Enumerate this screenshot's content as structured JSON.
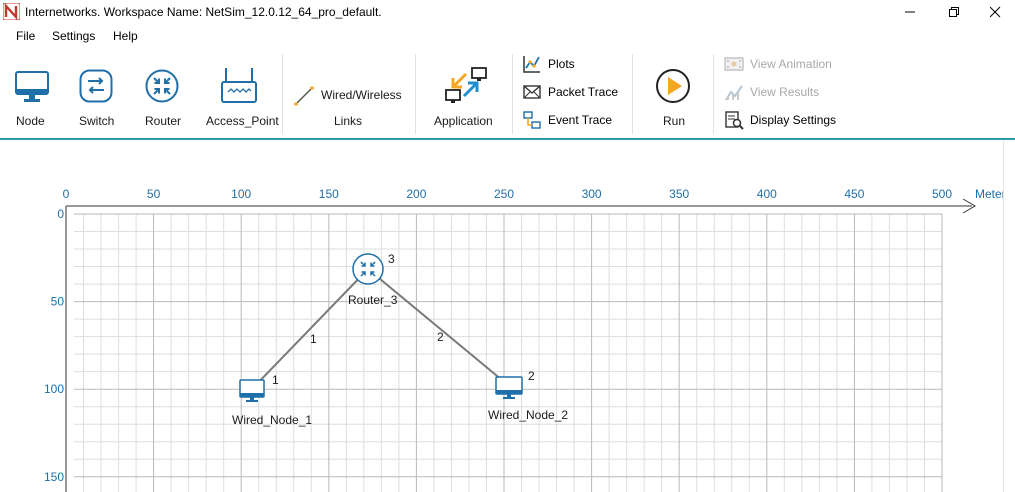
{
  "window": {
    "title": "Internetworks. Workspace Name: NetSim_12.0.12_64_pro_default.",
    "app_icon": "netsim-logo-icon"
  },
  "menu": [
    "File",
    "Settings",
    "Help"
  ],
  "ribbon": {
    "devices": [
      {
        "label": "Node",
        "icon": "monitor-icon"
      },
      {
        "label": "Switch",
        "icon": "switch-icon"
      },
      {
        "label": "Router",
        "icon": "router-icon"
      },
      {
        "label": "Access_Point",
        "icon": "access-point-icon"
      }
    ],
    "links": {
      "button_label": "Wired/Wireless",
      "group_label": "Links",
      "icon": "link-icon"
    },
    "application": {
      "label": "Application",
      "icon": "application-icon"
    },
    "analysis": [
      {
        "label": "Plots",
        "icon": "plots-icon"
      },
      {
        "label": "Packet Trace",
        "icon": "packet-trace-icon"
      },
      {
        "label": "Event Trace",
        "icon": "event-trace-icon"
      }
    ],
    "run": {
      "label": "Run",
      "icon": "play-icon"
    },
    "results": [
      {
        "label": "View Animation",
        "icon": "animation-icon",
        "enabled": false
      },
      {
        "label": "View Results",
        "icon": "results-icon",
        "enabled": false
      },
      {
        "label": "Display Settings",
        "icon": "display-settings-icon",
        "enabled": true
      }
    ]
  },
  "canvas": {
    "unit_label": "Meters",
    "x_ticks": [
      "0",
      "50",
      "100",
      "150",
      "200",
      "250",
      "300",
      "350",
      "400",
      "450",
      "500"
    ],
    "y_ticks": [
      "0",
      "50",
      "100",
      "150"
    ],
    "devices": [
      {
        "name": "Router_3",
        "id": "3",
        "type": "router",
        "x": 172,
        "y": 32
      },
      {
        "name": "Wired_Node_1",
        "id": "1",
        "type": "node",
        "x": 108,
        "y": 100
      },
      {
        "name": "Wired_Node_2",
        "id": "2",
        "type": "node",
        "x": 253,
        "y": 98
      }
    ],
    "links": [
      {
        "id": "1",
        "from": "Router_3",
        "to": "Wired_Node_1"
      },
      {
        "id": "2",
        "from": "Router_3",
        "to": "Wired_Node_2"
      }
    ]
  },
  "colors": {
    "accent": "#1f6fa8",
    "ribbon_border": "#2b9aa8",
    "run_orange": "#f5a623",
    "grid": "#d9d9d9"
  }
}
